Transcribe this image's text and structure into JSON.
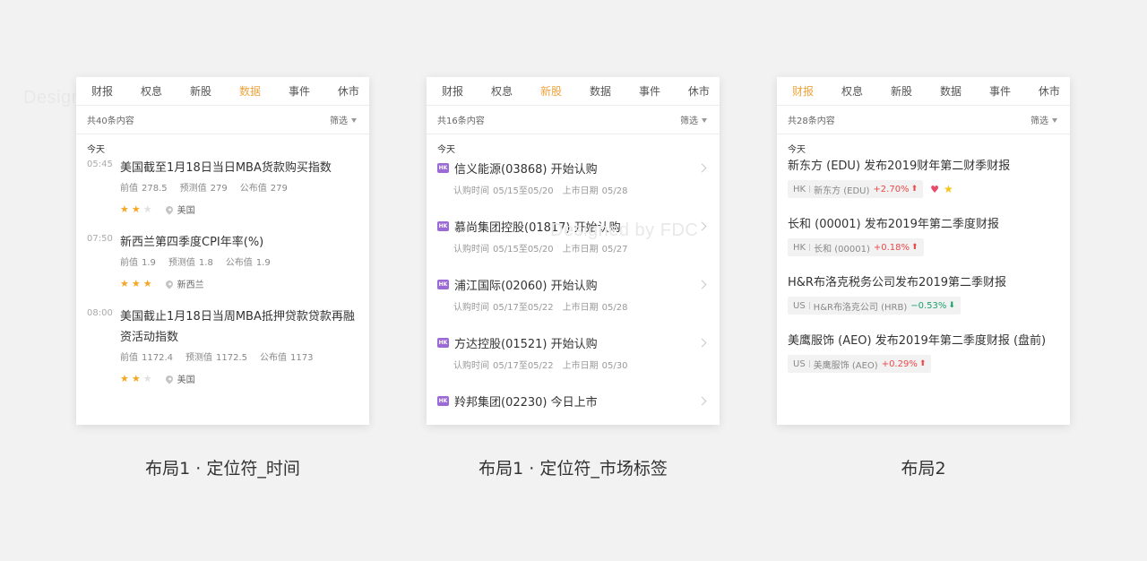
{
  "watermark": "Designed by FDC",
  "card1": {
    "tabs": [
      "财报",
      "权息",
      "新股",
      "数据",
      "事件",
      "休市"
    ],
    "active_tab": "数据",
    "count": "共40条内容",
    "filter": "筛选",
    "section": "今天",
    "items": [
      {
        "time": "05:45",
        "title": "美国截至1月18日当日MBA货款购买指数",
        "prev_label": "前值",
        "prev": "278.5",
        "fc_label": "预测值",
        "fc": "279",
        "pub_label": "公布值",
        "pub": "279",
        "stars": 2,
        "region": "美国"
      },
      {
        "time": "07:50",
        "title": "新西兰第四季度CPI年率(%)",
        "prev_label": "前值",
        "prev": "1.9",
        "fc_label": "预测值",
        "fc": "1.8",
        "pub_label": "公布值",
        "pub": "1.9",
        "stars": 3,
        "region": "新西兰"
      },
      {
        "time": "08:00",
        "title": "美国截止1月18日当周MBA抵押贷款贷款再融资活动指数",
        "prev_label": "前值",
        "prev": "1172.4",
        "fc_label": "预测值",
        "fc": "1172.5",
        "pub_label": "公布值",
        "pub": "1173",
        "stars": 2,
        "region": "美国"
      }
    ],
    "caption": "布局1 · 定位符_时间"
  },
  "card2": {
    "tabs": [
      "财报",
      "权息",
      "新股",
      "数据",
      "事件",
      "休市"
    ],
    "active_tab": "新股",
    "count": "共16条内容",
    "filter": "筛选",
    "section": "今天",
    "market_tag": "HK",
    "items": [
      {
        "name": "信义能源(03868) 开始认购",
        "sub_label": "认购时间",
        "sub": "05/15至05/20",
        "list_label": "上市日期",
        "list": "05/28"
      },
      {
        "name": "慕尚集团控股(01817) 开始认购",
        "sub_label": "认购时间",
        "sub": "05/15至05/20",
        "list_label": "上市日期",
        "list": "05/27"
      },
      {
        "name": "浦江国际(02060) 开始认购",
        "sub_label": "认购时间",
        "sub": "05/17至05/22",
        "list_label": "上市日期",
        "list": "05/28"
      },
      {
        "name": "方达控股(01521) 开始认购",
        "sub_label": "认购时间",
        "sub": "05/17至05/22",
        "list_label": "上市日期",
        "list": "05/30"
      },
      {
        "name": "羚邦集团(02230) 今日上市",
        "sub_label": "",
        "sub": "",
        "list_label": "",
        "list": ""
      }
    ],
    "caption": "布局1 · 定位符_市场标签"
  },
  "card3": {
    "tabs": [
      "财报",
      "权息",
      "新股",
      "数据",
      "事件",
      "休市"
    ],
    "active_tab": "财报",
    "count": "共28条内容",
    "filter": "筛选",
    "section": "今天",
    "items": [
      {
        "title": "新东方 (EDU) 发布2019财年第二财季财报",
        "market": "HK",
        "stock": "新东方 (EDU)",
        "change": "+2.70%",
        "dir": "up",
        "heart": true,
        "star": true
      },
      {
        "title": "长和 (00001) 发布2019年第二季度财报",
        "market": "HK",
        "stock": "长和 (00001)",
        "change": "+0.18%",
        "dir": "up",
        "heart": false,
        "star": false
      },
      {
        "title": "H&R布洛克税务公司发布2019第二季财报",
        "market": "US",
        "stock": "H&R布洛克公司 (HRB)",
        "change": "−0.53%",
        "dir": "down",
        "heart": false,
        "star": false
      },
      {
        "title": "美鹰服饰 (AEO) 发布2019年第二季度财报 (盘前)",
        "market": "US",
        "stock": "美鹰服饰 (AEO)",
        "change": "+0.29%",
        "dir": "up",
        "heart": false,
        "star": false
      }
    ],
    "caption": "布局2"
  },
  "colors": {
    "accent": "#f0a23c",
    "star": "#f5a623",
    "up": "#e84a4a",
    "down": "#1aa36a",
    "hk_tag": "#9b6ad6"
  }
}
